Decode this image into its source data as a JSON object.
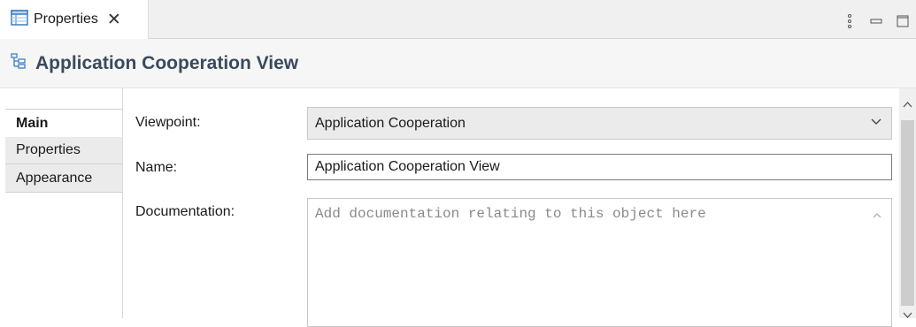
{
  "view_tab": {
    "label": "Properties"
  },
  "header": {
    "title": "Application Cooperation View"
  },
  "side_tabs": [
    {
      "label": "Main",
      "active": true
    },
    {
      "label": "Properties",
      "active": false
    },
    {
      "label": "Appearance",
      "active": false
    }
  ],
  "form": {
    "viewpoint_label": "Viewpoint:",
    "viewpoint_value": "Application Cooperation",
    "name_label": "Name:",
    "name_value": "Application Cooperation View",
    "documentation_label": "Documentation:",
    "documentation_placeholder": "Add documentation relating to this object here"
  },
  "icons": {
    "tab_icon": "properties-table-icon",
    "title_icon": "diagram-model-icon",
    "close": "close-icon",
    "menu": "view-menu-icon",
    "minimize": "minimize-icon",
    "maximize": "maximize-icon",
    "dropdown": "chevron-down-icon"
  },
  "colors": {
    "title_text": "#3a4a5c",
    "tab_icon_blue": "#3c7dc4"
  }
}
